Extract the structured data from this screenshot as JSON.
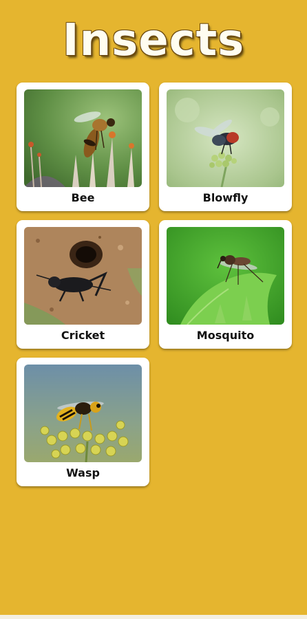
{
  "screen": {
    "title": "Insects",
    "background_color": "#e5b52f"
  },
  "cards": [
    {
      "label": "Bee",
      "image_icon": "bee-photo"
    },
    {
      "label": "Blowfly",
      "image_icon": "blowfly-photo"
    },
    {
      "label": "Cricket",
      "image_icon": "cricket-photo"
    },
    {
      "label": "Mosquito",
      "image_icon": "mosquito-photo"
    },
    {
      "label": "Wasp",
      "image_icon": "wasp-photo"
    }
  ]
}
